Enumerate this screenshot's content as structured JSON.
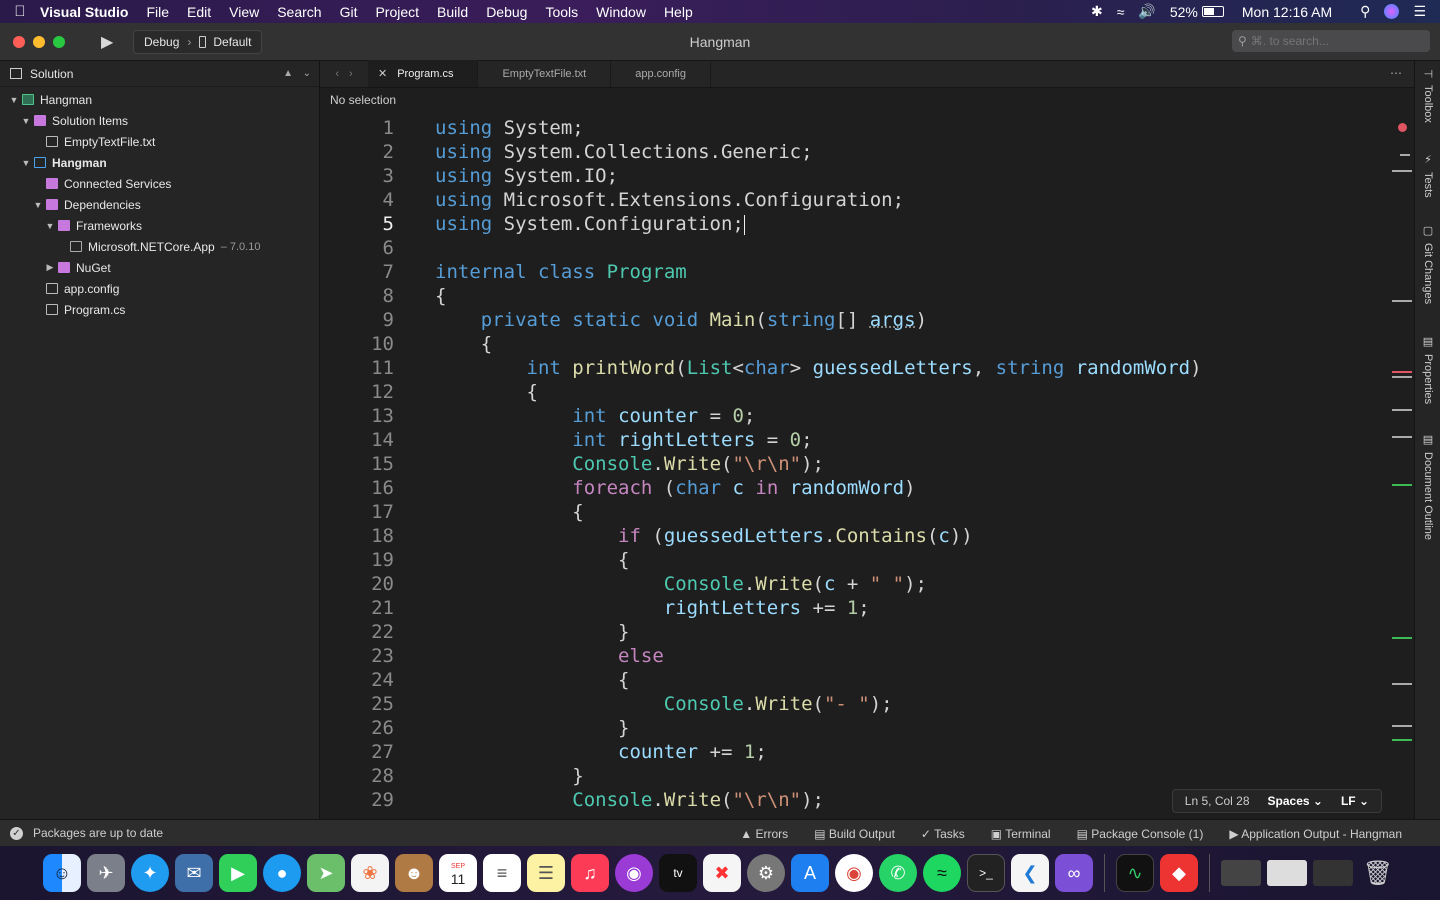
{
  "menubar": {
    "app_name": "Visual Studio",
    "items": [
      "File",
      "Edit",
      "View",
      "Search",
      "Git",
      "Project",
      "Build",
      "Debug",
      "Tools",
      "Window",
      "Help"
    ],
    "battery": "52%",
    "clock": "Mon 12:16 AM"
  },
  "toolbar": {
    "configuration": "Debug",
    "device": "Default",
    "window_title": "Hangman",
    "search_placeholder": "⌘. to search..."
  },
  "solution_pad": {
    "title": "Solution",
    "tree": [
      {
        "label": "Hangman",
        "level": 0,
        "icon": "solution-icon",
        "expanded": true,
        "bold": false
      },
      {
        "label": "Solution Items",
        "level": 1,
        "icon": "folder-icon",
        "expanded": true,
        "bold": false
      },
      {
        "label": "EmptyTextFile.txt",
        "level": 2,
        "icon": "file-icon",
        "expanded": null,
        "bold": false
      },
      {
        "label": "Hangman",
        "level": 1,
        "icon": "project-icon",
        "expanded": true,
        "bold": true
      },
      {
        "label": "Connected Services",
        "level": 2,
        "icon": "folder-icon",
        "expanded": null,
        "bold": false
      },
      {
        "label": "Dependencies",
        "level": 2,
        "icon": "folder-icon",
        "expanded": true,
        "bold": false
      },
      {
        "label": "Frameworks",
        "level": 3,
        "icon": "folder-icon",
        "expanded": true,
        "bold": false
      },
      {
        "label": "Microsoft.NETCore.App",
        "version": "– 7.0.10",
        "level": 4,
        "icon": "package-icon",
        "expanded": null,
        "bold": false
      },
      {
        "label": "NuGet",
        "level": 3,
        "icon": "folder-icon",
        "expanded": false,
        "bold": false
      },
      {
        "label": "app.config",
        "level": 2,
        "icon": "config-file-icon",
        "expanded": null,
        "bold": false
      },
      {
        "label": "Program.cs",
        "level": 2,
        "icon": "cs-file-icon",
        "expanded": null,
        "bold": false
      }
    ]
  },
  "editor": {
    "tabs": [
      {
        "label": "Program.cs",
        "active": true
      },
      {
        "label": "EmptyTextFile.txt",
        "active": false
      },
      {
        "label": "app.config",
        "active": false
      }
    ],
    "selection_text": "No selection",
    "cursor_position": "Ln 5, Col 28",
    "indentation": "Spaces",
    "line_endings": "LF",
    "current_line": 5
  },
  "side_pads": [
    "Toolbox",
    "Tests",
    "Git Changes",
    "Properties",
    "Document Outline"
  ],
  "status_bar": {
    "message": "Packages are up to date",
    "pads": [
      "Errors",
      "Build Output",
      "Tasks",
      "Terminal",
      "Package Console (1)",
      "Application Output - Hangman"
    ]
  },
  "dock": {
    "calendar_month": "SEP",
    "calendar_day": "11"
  },
  "colors": {
    "keyword": "#569cd6",
    "control_keyword": "#c586c0",
    "type": "#4ec9b0",
    "method": "#dcdcaa",
    "identifier": "#9cdcfe",
    "string": "#ce9178",
    "number": "#b5cea8"
  }
}
